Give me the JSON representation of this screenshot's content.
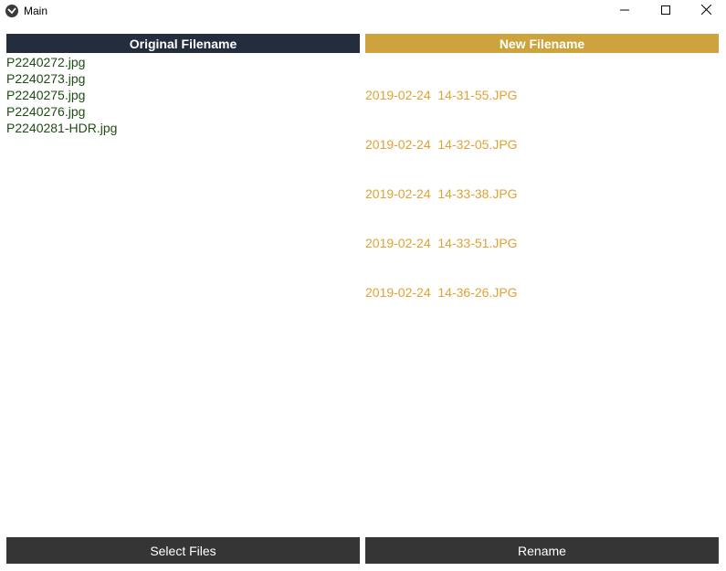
{
  "window": {
    "title": "Main"
  },
  "columns": {
    "original_header": "Original Filename",
    "new_header": "New Filename"
  },
  "original_files": [
    "P2240272.jpg",
    "P2240273.jpg",
    "P2240275.jpg",
    "P2240276.jpg",
    "P2240281-HDR.jpg"
  ],
  "new_files": [
    "2019-02-24  14-31-55.JPG",
    "2019-02-24  14-32-05.JPG",
    "2019-02-24  14-33-38.JPG",
    "2019-02-24  14-33-51.JPG",
    "2019-02-24  14-36-26.JPG"
  ],
  "buttons": {
    "select_files": "Select Files",
    "rename": "Rename"
  },
  "colors": {
    "left_header_bg": "#242d3e",
    "right_header_bg": "#cca33d",
    "original_text": "#1e4d14",
    "new_text": "#e0a233",
    "button_bg": "#353535"
  },
  "icons": {
    "app": "kivy-app-icon",
    "minimize": "minimize-icon",
    "maximize": "maximize-icon",
    "close": "close-icon"
  }
}
